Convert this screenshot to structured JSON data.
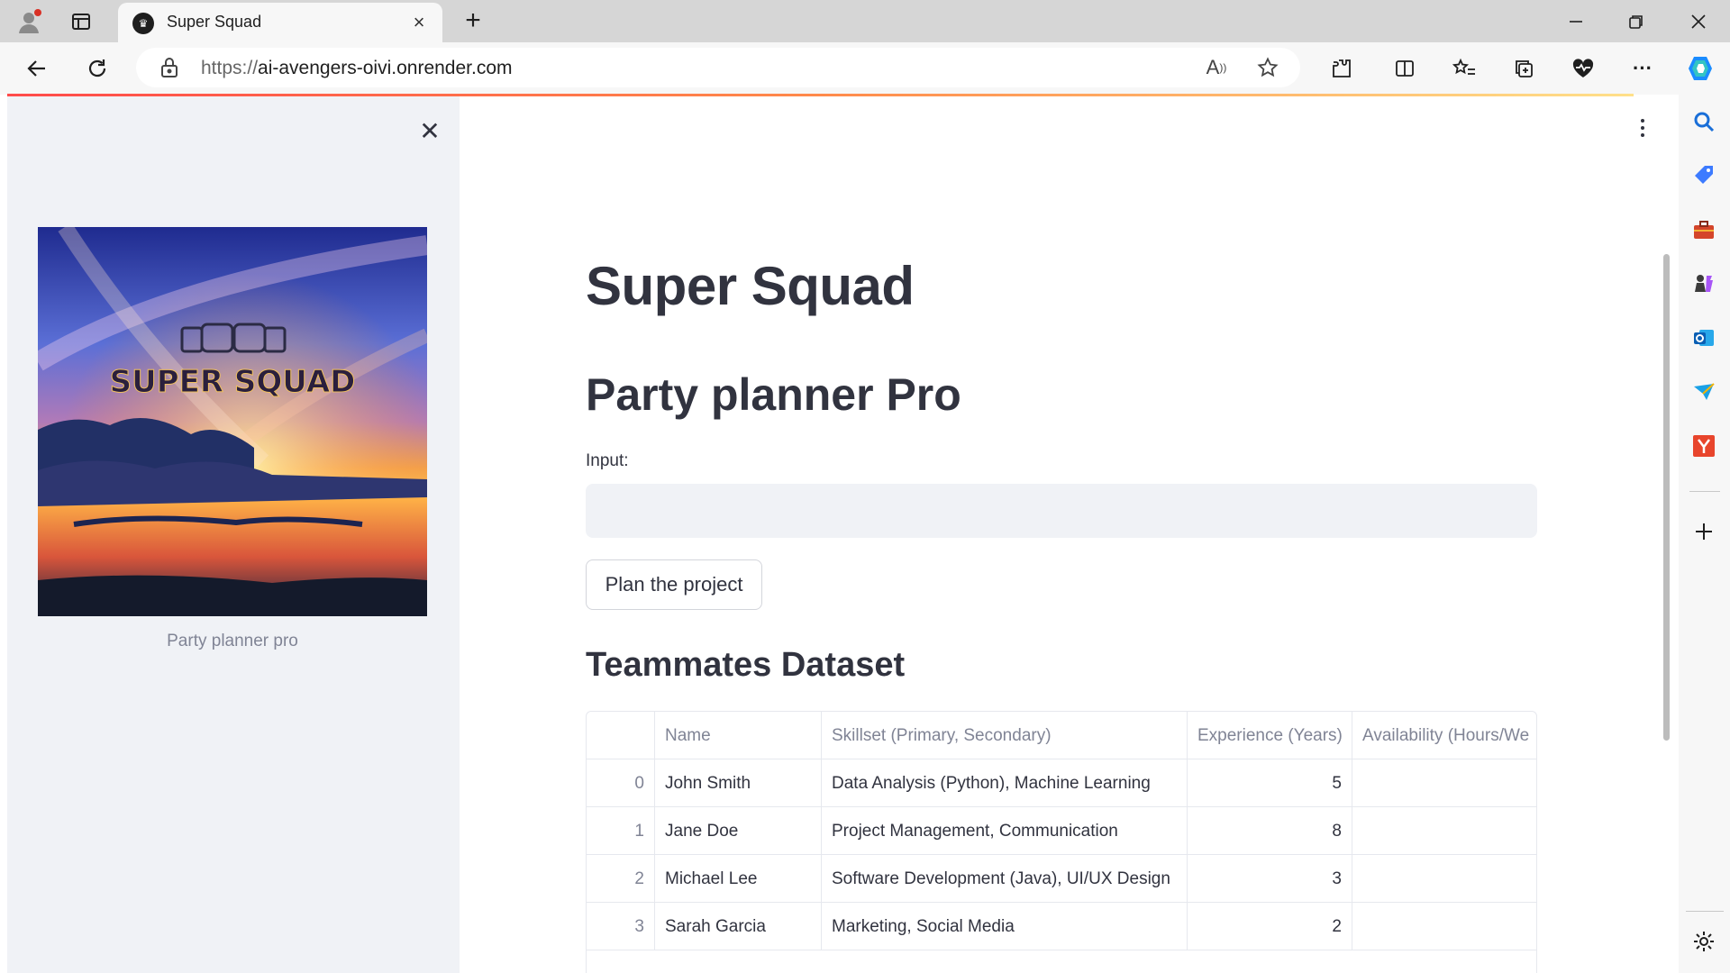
{
  "browser": {
    "tab_title": "Super Squad",
    "url_scheme": "https://",
    "url_host": "ai-avengers-oivi.onrender.com"
  },
  "sidebar": {
    "image_caption": "Party planner pro",
    "image_text": "SUPER SQUAD"
  },
  "main": {
    "title": "Super Squad",
    "subtitle": "Party planner Pro",
    "input_label": "Input:",
    "input_value": "",
    "button_label": "Plan the project",
    "dataset_heading": "Teammates Dataset"
  },
  "table": {
    "columns": [
      "",
      "Name",
      "Skillset (Primary, Secondary)",
      "Experience (Years)",
      "Availability (Hours/We"
    ],
    "rows": [
      {
        "index": "0",
        "name": "John Smith",
        "skillset": "Data Analysis (Python), Machine Learning",
        "experience": "5",
        "availability": ""
      },
      {
        "index": "1",
        "name": "Jane Doe",
        "skillset": "Project Management, Communication",
        "experience": "8",
        "availability": ""
      },
      {
        "index": "2",
        "name": "Michael Lee",
        "skillset": "Software Development (Java), UI/UX Design",
        "experience": "3",
        "availability": ""
      },
      {
        "index": "3",
        "name": "Sarah Garcia",
        "skillset": "Marketing, Social Media",
        "experience": "2",
        "availability": ""
      }
    ]
  },
  "theme": {
    "accent": "#ff4b4b",
    "sidebar_bg": "#f0f2f6",
    "text": "#31333f"
  }
}
